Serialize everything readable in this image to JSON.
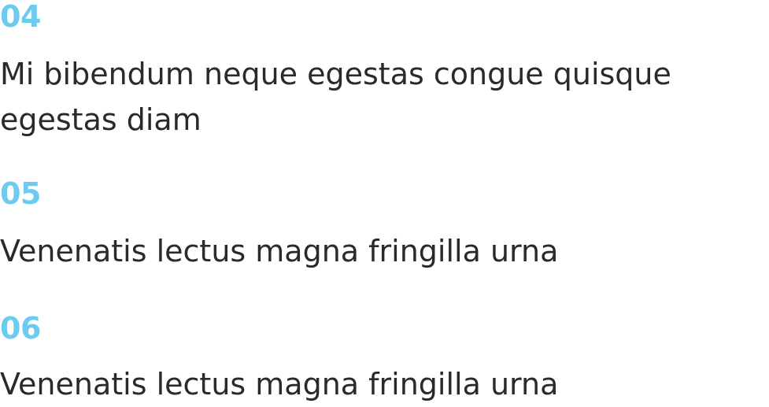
{
  "colors": {
    "accent": "#6ccbee",
    "body_text": "#2a2a2a",
    "background": "#ffffff"
  },
  "items": [
    {
      "number": "04",
      "text": "Mi bibendum neque egestas congue quisque egestas diam"
    },
    {
      "number": "05",
      "text": "Venenatis lectus magna fringilla urna"
    },
    {
      "number": "06",
      "text": "Venenatis lectus magna fringilla urna"
    }
  ]
}
